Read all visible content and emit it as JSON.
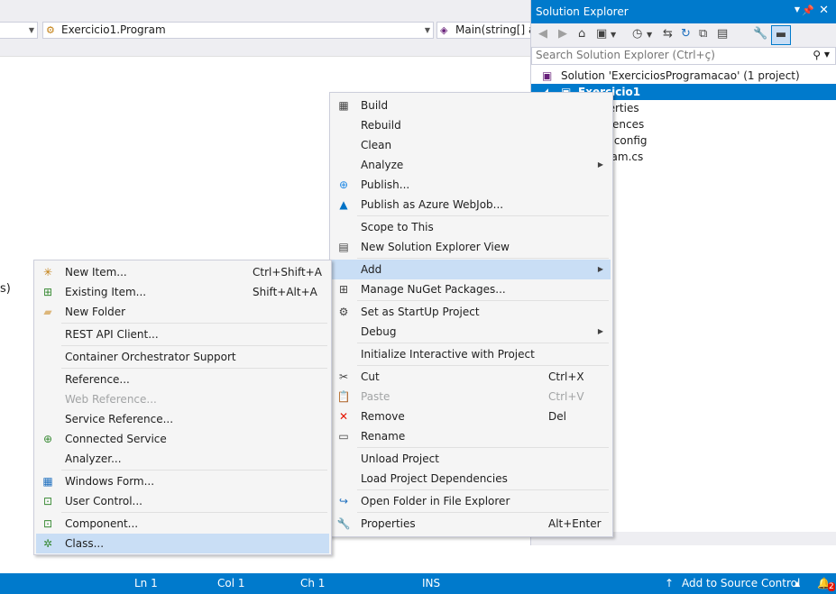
{
  "nav": {
    "combo1_text": "",
    "combo2_text": "Exercicio1.Program",
    "combo3_text": "Main(string[] ar"
  },
  "editor": {
    "paren": "s)"
  },
  "solution_explorer": {
    "title": "Solution Explorer",
    "search_placeholder": "Search Solution Explorer (Ctrl+ç)",
    "tree": [
      {
        "label": "Solution 'ExerciciosProgramacao' (1 project)"
      },
      {
        "label": "Exercicio1"
      },
      {
        "label": "perties"
      },
      {
        "label": "erences"
      },
      {
        "label": ".config"
      },
      {
        "label": "gram.cs"
      }
    ]
  },
  "context_menu": {
    "items": [
      {
        "label": "Build",
        "icon": "build-icon"
      },
      {
        "label": "Rebuild"
      },
      {
        "label": "Clean"
      },
      {
        "label": "Analyze"
      },
      {
        "label": "Publish...",
        "icon": "globe-icon"
      },
      {
        "label": "Publish as Azure WebJob...",
        "icon": "azure-icon"
      },
      {
        "label": "Scope to This"
      },
      {
        "label": "New Solution Explorer View",
        "icon": "window-icon"
      },
      {
        "label": "Add"
      },
      {
        "label": "Manage NuGet Packages...",
        "icon": "nuget-icon"
      },
      {
        "label": "Set as StartUp Project",
        "icon": "gear-icon"
      },
      {
        "label": "Debug"
      },
      {
        "label": "Initialize Interactive with Project"
      },
      {
        "label": "Cut",
        "shortcut": "Ctrl+X",
        "icon": "scissors-icon"
      },
      {
        "label": "Paste",
        "shortcut": "Ctrl+V",
        "icon": "paste-icon"
      },
      {
        "label": "Remove",
        "shortcut": "Del",
        "icon": "remove-icon"
      },
      {
        "label": "Rename",
        "icon": "rename-icon"
      },
      {
        "label": "Unload Project"
      },
      {
        "label": "Load Project Dependencies"
      },
      {
        "label": "Open Folder in File Explorer",
        "icon": "refresh-folder-icon"
      },
      {
        "label": "Properties",
        "shortcut": "Alt+Enter",
        "icon": "wrench-icon"
      }
    ]
  },
  "add_submenu": {
    "items": [
      {
        "label": "New Item...",
        "shortcut": "Ctrl+Shift+A"
      },
      {
        "label": "Existing Item...",
        "shortcut": "Shift+Alt+A"
      },
      {
        "label": "New Folder"
      },
      {
        "label": "REST API Client..."
      },
      {
        "label": "Container Orchestrator Support"
      },
      {
        "label": "Reference..."
      },
      {
        "label": "Web Reference..."
      },
      {
        "label": "Service Reference..."
      },
      {
        "label": "Connected Service"
      },
      {
        "label": "Analyzer..."
      },
      {
        "label": "Windows Form..."
      },
      {
        "label": "User Control..."
      },
      {
        "label": "Component..."
      },
      {
        "label": "Class..."
      }
    ]
  },
  "status_bar": {
    "ln": "Ln 1",
    "col": "Col 1",
    "ch": "Ch 1",
    "ins": "INS",
    "source_control": "Add to Source Control",
    "notifications": "2"
  },
  "colors": {
    "accent": "#007acc",
    "highlight": "#c9def5"
  }
}
